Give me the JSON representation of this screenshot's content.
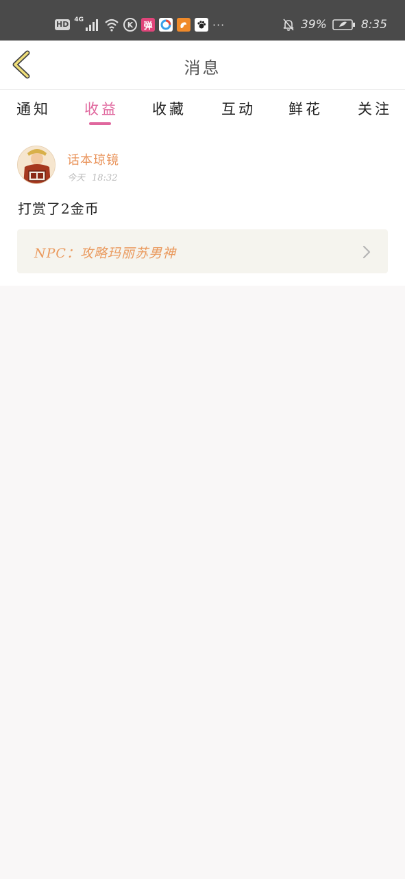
{
  "status_bar": {
    "hd": "HD",
    "network": "4G",
    "app_icon_dan": "弹",
    "k_icon": "K",
    "more": "···",
    "battery_percent": "39%",
    "time": "8:35"
  },
  "header": {
    "title": "消息"
  },
  "tabs": [
    {
      "label": "通知",
      "active": false
    },
    {
      "label": "收益",
      "active": true
    },
    {
      "label": "收藏",
      "active": false
    },
    {
      "label": "互动",
      "active": false
    },
    {
      "label": "鲜花",
      "active": false
    },
    {
      "label": "关注",
      "active": false
    }
  ],
  "message": {
    "sender_name": "话本琼镜",
    "date": "今天",
    "time": "18:32",
    "text": "打赏了2金币",
    "work_title": "NPC：攻略玛丽苏男神"
  },
  "colors": {
    "accent": "#e0679e",
    "name": "#e9935a",
    "link_bg": "#f5f4ee",
    "page_bg": "#f9f7f7"
  }
}
